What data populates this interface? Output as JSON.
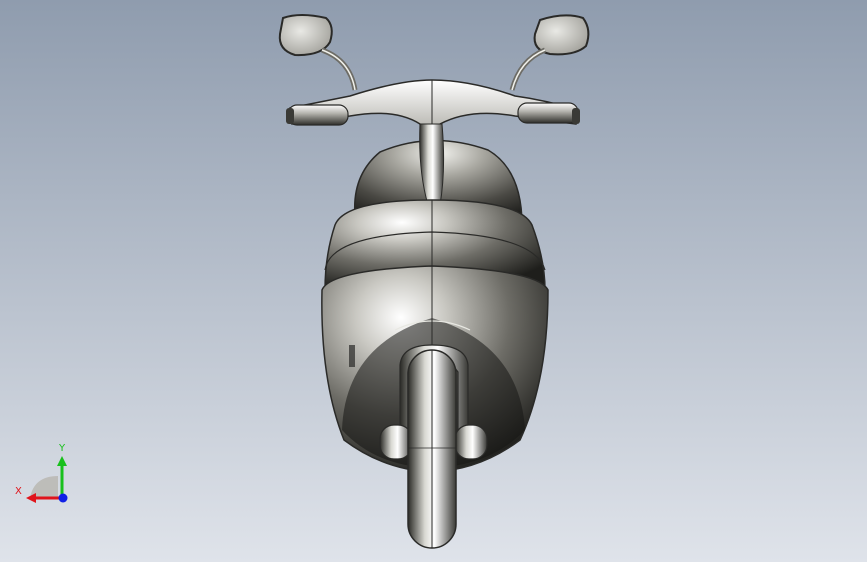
{
  "viewport": {
    "background_top": "#8f9cae",
    "background_bottom": "#dfe3ea",
    "model": "scooter-front-view"
  },
  "triad": {
    "x_label": "X",
    "y_label": "Y",
    "x_color": "#e0141b",
    "y_color": "#18c01c",
    "z_color": "#1020e6"
  },
  "colors": {
    "body_light": "#f4f4f0",
    "body_mid": "#8d8c86",
    "body_dark": "#1c1c19",
    "edge": "#2a2a28"
  }
}
